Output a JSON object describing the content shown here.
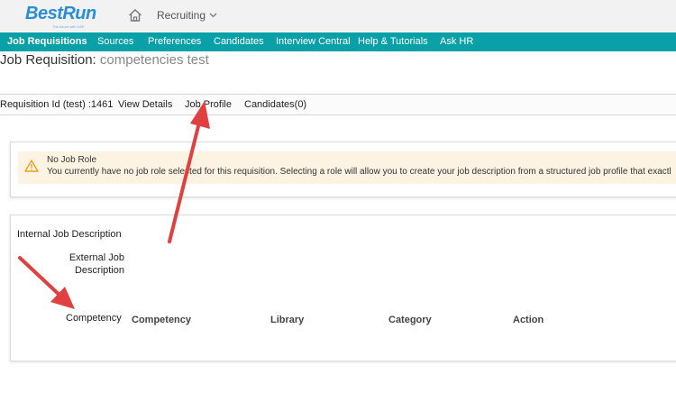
{
  "header": {
    "logo_text": "BestRun",
    "logo_tagline": "The future with SAP",
    "module": "Recruiting"
  },
  "nav": {
    "items": [
      {
        "label": "Job Requisitions"
      },
      {
        "label": "Sources"
      },
      {
        "label": "Preferences"
      },
      {
        "label": "Candidates"
      },
      {
        "label": "Interview Central"
      },
      {
        "label": "Help & Tutorials"
      },
      {
        "label": "Ask HR"
      }
    ]
  },
  "page": {
    "title_prefix": "Job Requisition:",
    "title_name": "competencies test"
  },
  "subnav": {
    "requisition_id": "Requisition Id (test) :1461",
    "view_details": "View Details",
    "job_profile": "Job Profile",
    "candidates": "Candidates(0)"
  },
  "alert": {
    "title": "No Job Role",
    "message": "You currently have no job role selected for this requisition. Selecting a role will allow you to create your job description from a structured job profile that exactl"
  },
  "job_description": {
    "internal": "Internal Job Description",
    "external": "External Job Description",
    "competency_label": "Competency",
    "columns": [
      "Competency",
      "Library",
      "Category",
      "Action"
    ]
  },
  "colors": {
    "nav_bg": "#0aa0a8",
    "logo": "#2b8ed8",
    "alert_bg": "#fdf3e3",
    "warning": "#e8a020",
    "annotation_arrow": "#e04040"
  }
}
